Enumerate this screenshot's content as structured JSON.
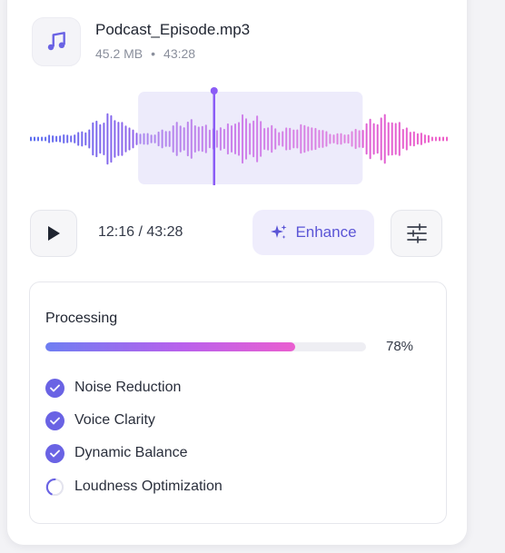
{
  "file": {
    "name": "Podcast_Episode.mp3",
    "size": "45.2 MB",
    "separator": "•",
    "duration": "43:28",
    "icon": "music-note-icon"
  },
  "waveform": {
    "playhead_fraction": 0.441,
    "selection_start_fraction": 0.26,
    "selection_end_fraction": 0.795,
    "colors": [
      "#5b6ef0",
      "#c55ee6",
      "#ef5fc8"
    ]
  },
  "player": {
    "time": "12:16 / 43:28",
    "enhance_label": "Enhance",
    "accent_color": "#5b55d6"
  },
  "processing": {
    "title": "Processing",
    "progress": 0.78,
    "progress_label": "78%",
    "steps": [
      {
        "label": "Noise Reduction",
        "status": "done"
      },
      {
        "label": "Voice Clarity",
        "status": "done"
      },
      {
        "label": "Dynamic Balance",
        "status": "done"
      },
      {
        "label": "Loudness Optimization",
        "status": "in-progress"
      }
    ]
  }
}
